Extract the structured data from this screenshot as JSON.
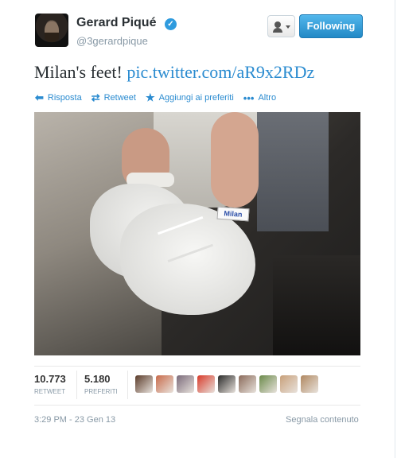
{
  "header": {
    "name": "Gerard Piqué",
    "handle": "@3gerardpique",
    "follow_label": "Following"
  },
  "tweet": {
    "text": "Milan's feet!",
    "link": "pic.twitter.com/aR9x2RDz"
  },
  "photo": {
    "shoe_tag": "Milan"
  },
  "actions": [
    {
      "icon": "reply-icon",
      "label": "Risposta"
    },
    {
      "icon": "retweet-icon",
      "label": "Retweet"
    },
    {
      "icon": "star-icon",
      "label": "Aggiungi ai preferiti"
    },
    {
      "icon": "more-icon",
      "label": "Altro"
    }
  ],
  "stats": {
    "retweets": {
      "value": "10.773",
      "label": "RETWEET"
    },
    "favorites": {
      "value": "5.180",
      "label": "PREFERITI"
    }
  },
  "favoriters": {
    "colors": [
      "#5a3b2a",
      "#c86a4a",
      "#7a6a7a",
      "#d83a2a",
      "#2a2a2a",
      "#8a6a5a",
      "#6a8a4a",
      "#c8a07a",
      "#b08860"
    ]
  },
  "footer": {
    "timestamp": "3:29 PM - 23 Gen 13",
    "report_label": "Segnala contenuto"
  },
  "colors": {
    "link": "#2a8bd0",
    "verified": "#2f9bde",
    "follow_button": "#2289c6"
  }
}
